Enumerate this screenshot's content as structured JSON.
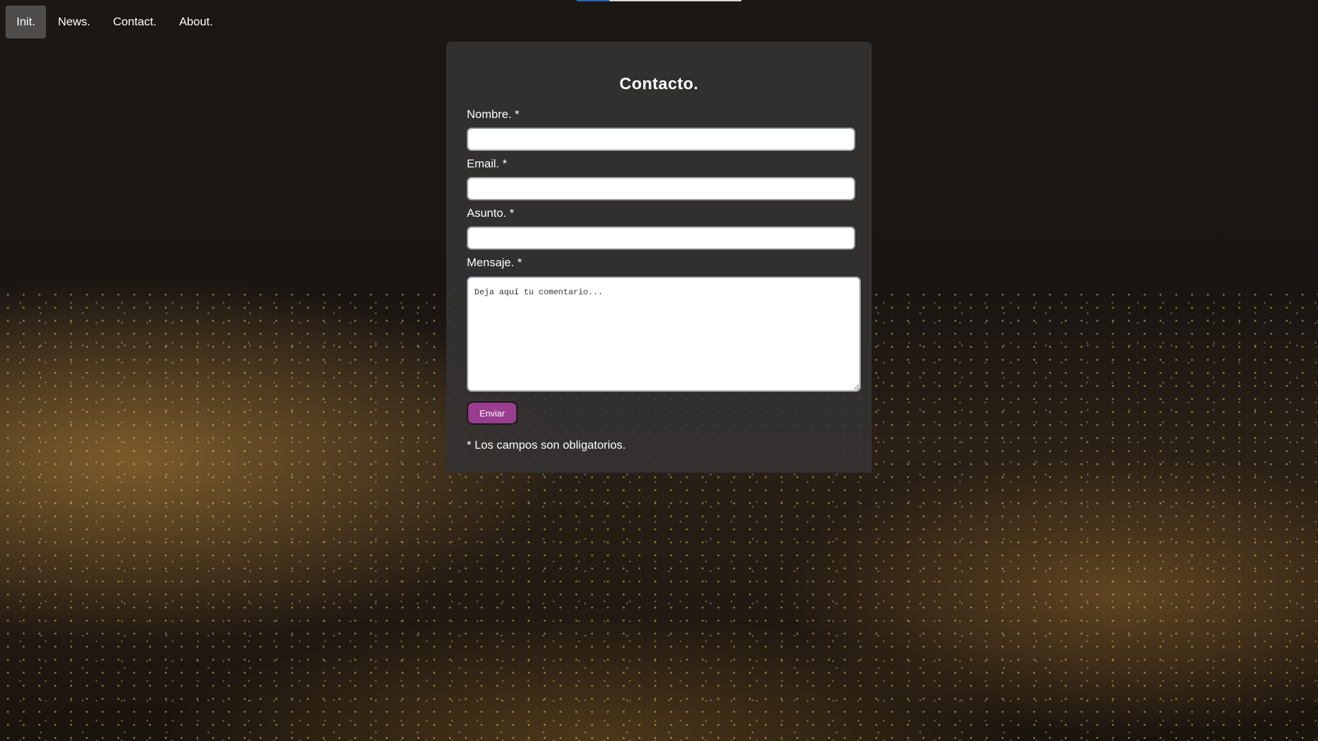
{
  "nav": {
    "items": [
      {
        "label": "Init.",
        "active": true
      },
      {
        "label": "News.",
        "active": false
      },
      {
        "label": "Contact.",
        "active": false
      },
      {
        "label": "About.",
        "active": false
      }
    ]
  },
  "form": {
    "title": "Contacto.",
    "fields": {
      "nombre": {
        "label": "Nombre. *",
        "value": ""
      },
      "email": {
        "label": "Email. *",
        "value": ""
      },
      "asunto": {
        "label": "Asunto. *",
        "value": ""
      },
      "mensaje": {
        "label": "Mensaje. *",
        "placeholder": "Deja aquí tu comentario..."
      }
    },
    "submit_label": "Enviar",
    "required_note": "* Los campos son obligatorios."
  },
  "colors": {
    "panel_bg": "#343231",
    "button_bg": "#9b3d8f",
    "text": "#ffffff"
  }
}
